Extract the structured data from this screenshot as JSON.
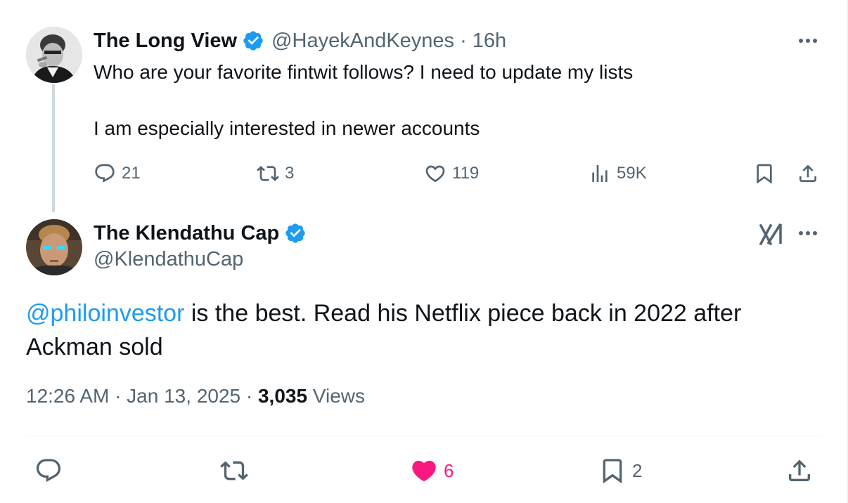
{
  "parent": {
    "name": "The Long View",
    "handle": "@HayekAndKeynes",
    "separator": "·",
    "time": "16h",
    "line1": "Who are your favorite fintwit follows? I need to update my lists",
    "line2": "I am especially interested in newer accounts",
    "replies": "21",
    "reposts": "3",
    "likes": "119",
    "views": "59K"
  },
  "reply": {
    "name": "The Klendathu Cap",
    "handle": "@KlendathuCap",
    "mention": "@philoinvestor",
    "body_rest": " is the best. Read his Netflix piece back in 2022 after Ackman sold",
    "timestamp": "12:26 AM · Jan 13, 2025 · ",
    "views_count": "3,035",
    "views_label": " Views",
    "likes": "6",
    "bookmarks": "2"
  },
  "colors": {
    "accent": "#1d9bf0",
    "muted": "#536471",
    "like": "#f91880",
    "text": "#0f1419"
  },
  "icons": [
    "verified-badge-icon",
    "more-icon",
    "reply-icon",
    "repost-icon",
    "like-icon",
    "views-icon",
    "bookmark-icon",
    "share-icon",
    "grok-icon"
  ]
}
